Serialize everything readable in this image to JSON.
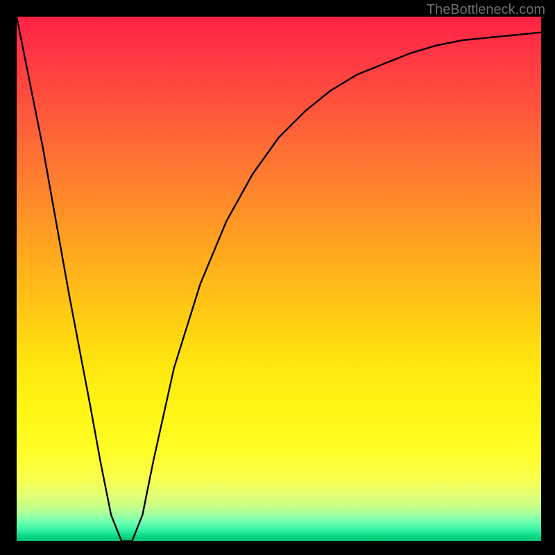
{
  "watermark_text": "TheBottleneck.com",
  "chart_data": {
    "type": "line",
    "title": "",
    "xlabel": "",
    "ylabel": "",
    "xlim": [
      0,
      100
    ],
    "ylim": [
      0,
      100
    ],
    "x": [
      0,
      5,
      10,
      14,
      16,
      18,
      20,
      22,
      24,
      26,
      30,
      35,
      40,
      45,
      50,
      55,
      60,
      65,
      70,
      75,
      80,
      85,
      90,
      95,
      100
    ],
    "y": [
      100,
      75,
      47,
      26,
      15,
      5,
      0,
      0,
      5,
      15,
      33,
      49,
      61,
      70,
      77,
      82,
      86,
      89,
      91,
      93,
      94.5,
      95.5,
      96,
      96.5,
      97
    ],
    "minimum_x": 21,
    "minimum_marker": {
      "x": 21,
      "y": -1,
      "rx": 18,
      "ry": 7
    },
    "colors": {
      "gradient_top": "#ff2244",
      "gradient_bottom": "#00c070",
      "curve": "#000000",
      "marker": "#d36a70"
    }
  }
}
